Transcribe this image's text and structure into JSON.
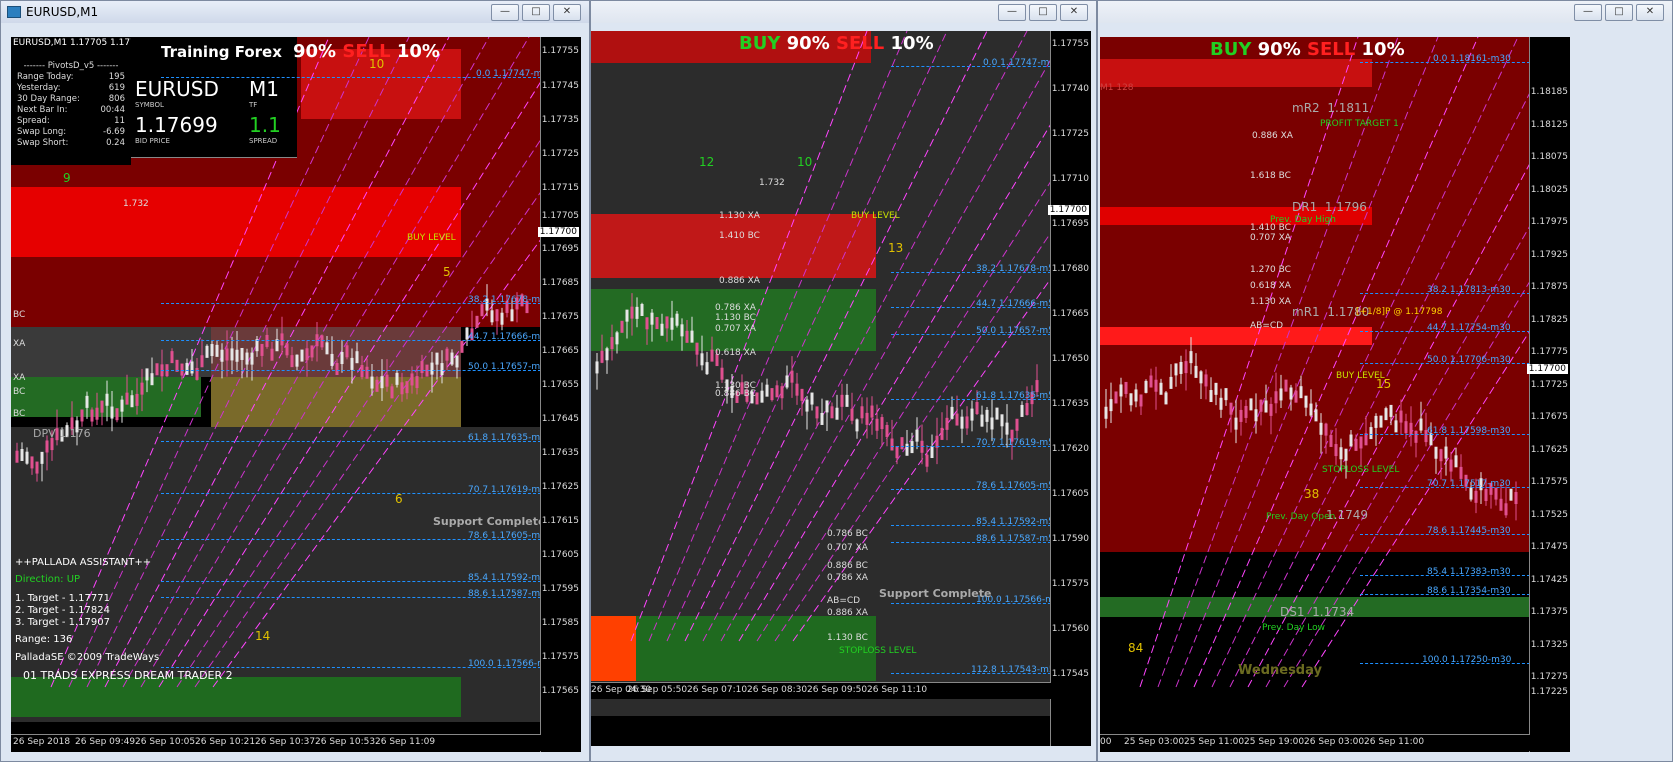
{
  "windows": [
    {
      "title": "EURUSD,M1",
      "chart_header": "EURUSD,M1  1.17705 1.17705",
      "buy_label": "BUY",
      "buy_pct": "90%",
      "sell_label": "SELL",
      "sell_pct": "10%",
      "training": "Training Forex",
      "pivots": {
        "title": "------- PivotsD_v5 -------",
        "rows": [
          {
            "k": "Range  Today:",
            "v": "195"
          },
          {
            "k": "Yesterday:",
            "v": "619"
          },
          {
            "k": "30 Day Range:",
            "v": "806"
          },
          {
            "k": "Next Bar In:",
            "v": "00:44"
          },
          {
            "k": "Spread:",
            "v": "11"
          },
          {
            "k": "Swap  Long:",
            "v": "-6.69"
          },
          {
            "k": "Swap  Short:",
            "v": "0.24"
          }
        ]
      },
      "ticker": {
        "symbol": "EURUSD",
        "symbol_caption": "SYMBOL",
        "tf": "M1",
        "tf_caption": "TF",
        "bid": "1.17699",
        "bid_caption": "BID PRICE",
        "spread": "1.1",
        "spread_caption": "SPREAD"
      },
      "assistant": {
        "title": "++PALLADA ASSISTANT++",
        "direction": "Direction: UP",
        "targets": [
          "1. Target - 1.17771",
          "2. Target - 1.17824",
          "3. Target - 1.17907"
        ],
        "range": "Range: 136",
        "copyright": "PalladaSE ©2009 TradeWays",
        "footer": "01 TRADS EXPRESS DREAM TRADER 2"
      },
      "support_text": "Support Complete",
      "dpv": "DPV 1.176",
      "price_labels": [
        "1.17755",
        "1.17745",
        "1.17735",
        "1.17725",
        "1.17715",
        "1.17705",
        "1.17695",
        "1.17685",
        "1.17675",
        "1.17665",
        "1.17655",
        "1.17645",
        "1.17635",
        "1.17625",
        "1.17615",
        "1.17605",
        "1.17595",
        "1.17585",
        "1.17575",
        "1.17565"
      ],
      "current_price": "1.17700",
      "fib_levels": [
        "0.0  1.17747-m1",
        "38.2  1.17678-m1",
        "44.7  1.17666-m1",
        "50.0  1.17657-m1",
        "61.8  1.17635-m1",
        "70.7  1.17619-m1",
        "78.6  1.17605-m1",
        "85.4  1.17592-m1",
        "88.6  1.17587-m1",
        "100.0  1.17566-m1"
      ],
      "time_labels": [
        "26 Sep 2018",
        "26 Sep 09:49",
        "26 Sep 10:05",
        "26 Sep 10:21",
        "26 Sep 10:37",
        "26 Sep 10:53",
        "26 Sep 11:09"
      ],
      "numbers": [
        "9",
        "10",
        "5",
        "6",
        "14"
      ],
      "buy_level": "BUY LEVEL",
      "stray": "1.732",
      "side_labels": [
        "BC",
        "XA",
        "XA",
        "BC",
        "BC"
      ]
    },
    {
      "title": "",
      "buy_label": "BUY",
      "buy_pct": "90%",
      "sell_label": "SELL",
      "sell_pct": "10%",
      "price_labels": [
        "1.17755",
        "1.17740",
        "1.17725",
        "1.17710",
        "1.17695",
        "1.17680",
        "1.17665",
        "1.17650",
        "1.17635",
        "1.17620",
        "1.17605",
        "1.17590",
        "1.17575",
        "1.17560",
        "1.17545"
      ],
      "current_price": "1.17700",
      "fib_levels": [
        "0.0  1.17747-m5",
        "38.2  1.17678-m5",
        "44.7  1.17666-m5",
        "50.0  1.17657-m5",
        "61.8  1.17635-m5",
        "70.7  1.17619-m5",
        "78.6  1.17605-m5",
        "85.4  1.17592-m5",
        "88.6  1.17587-m5",
        "100.0  1.17566-m5",
        "112.8  1.17543-m5"
      ],
      "time_labels": [
        "26 Sep 04:30",
        "26 Sep 05:50",
        "26 Sep 07:10",
        "26 Sep 08:30",
        "26 Sep 09:50",
        "26 Sep 11:10"
      ],
      "numbers": [
        "12",
        "10",
        "13"
      ],
      "support_text": "Support Complete",
      "stoploss": "STOPLOSS LEVEL",
      "buy_level": "BUY LEVEL",
      "patterns": [
        "1.130 XA",
        "1.410 BC",
        "0.886 XA",
        "0.786 XA",
        "1.130 BC",
        "0.707 XA",
        "0.618 XA",
        "1.130 BC",
        "0.886 BC",
        "0.786 BC",
        "0.707 XA",
        "0.886 BC",
        "0.786 XA",
        "AB=CD",
        "0.886 XA",
        "1.130 BC",
        "1.732"
      ]
    },
    {
      "title": "",
      "buy_label": "BUY",
      "buy_pct": "90%",
      "sell_label": "SELL",
      "sell_pct": "10%",
      "price_labels": [
        "1.18185",
        "1.18125",
        "1.18075",
        "1.18025",
        "1.17975",
        "1.17925",
        "1.17875",
        "1.17825",
        "1.17775",
        "1.17725",
        "1.17675",
        "1.17625",
        "1.17575",
        "1.17525",
        "1.17475",
        "1.17425",
        "1.17375",
        "1.17325",
        "1.17275",
        "1.17225"
      ],
      "current_price": "1.17700",
      "fib_levels": [
        "0.0  1.18161-m30",
        "38.2  1.17813-m30",
        "44.7  1.17754-m30",
        "50.0  1.17706-m30",
        "61.8  1.17598-m30",
        "70.7  1.17517-m30",
        "78.6  1.17445-m30",
        "85.4  1.17383-m30",
        "88.6  1.17354-m30",
        "100.0  1.17250-m30"
      ],
      "time_labels": [
        "00",
        "25 Sep 03:00",
        "25 Sep 11:00",
        "25 Sep 19:00",
        "26 Sep 03:00",
        "26 Sep 11:00"
      ],
      "pivots": [
        {
          "name": "mR2",
          "value": "1.1811"
        },
        {
          "name": "DR1",
          "value": "1.1796"
        },
        {
          "name": "mR1",
          "value": "1.1780"
        },
        {
          "name": "DS1",
          "value": "1.1734"
        }
      ],
      "notes": {
        "profit_target": "PROFIT TARGET 1",
        "prev_high": "Prev. Day High",
        "prev_low": "Prev. Day Low",
        "prev_open": "Prev. Day Open",
        "open_val": "1.1749",
        "plus": "[+1/8]P @ 1.17798",
        "buy_level": "BUY LEVEL",
        "stoploss": "STOPLOSS LEVEL",
        "weekday": "Wednesday",
        "m1": "M1 128"
      },
      "numbers": [
        "15",
        "38",
        "84"
      ],
      "patterns": [
        "0.886 XA",
        "1.618 BC",
        "1.410 BC",
        "0.707 XA",
        "1.270 BC",
        "0.618 XA",
        "AB=CD",
        "1.130 XA"
      ]
    }
  ]
}
